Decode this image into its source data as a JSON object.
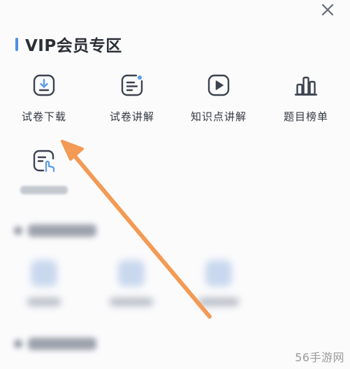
{
  "close": {
    "symbol": "✕"
  },
  "section": {
    "title": "VIP会员专区",
    "accent_color": "#4f8ee8"
  },
  "tiles": [
    {
      "label": "试卷下载",
      "icon": "download-icon"
    },
    {
      "label": "试卷讲解",
      "icon": "document-icon"
    },
    {
      "label": "知识点讲解",
      "icon": "play-icon"
    },
    {
      "label": "题目榜单",
      "icon": "bar-chart-icon"
    }
  ],
  "annotation": {
    "arrow_color": "#f39a55"
  },
  "watermark": {
    "text": "56手游网"
  },
  "colors": {
    "icon_stroke": "#3d4350",
    "icon_accent": "#5b9be8"
  }
}
